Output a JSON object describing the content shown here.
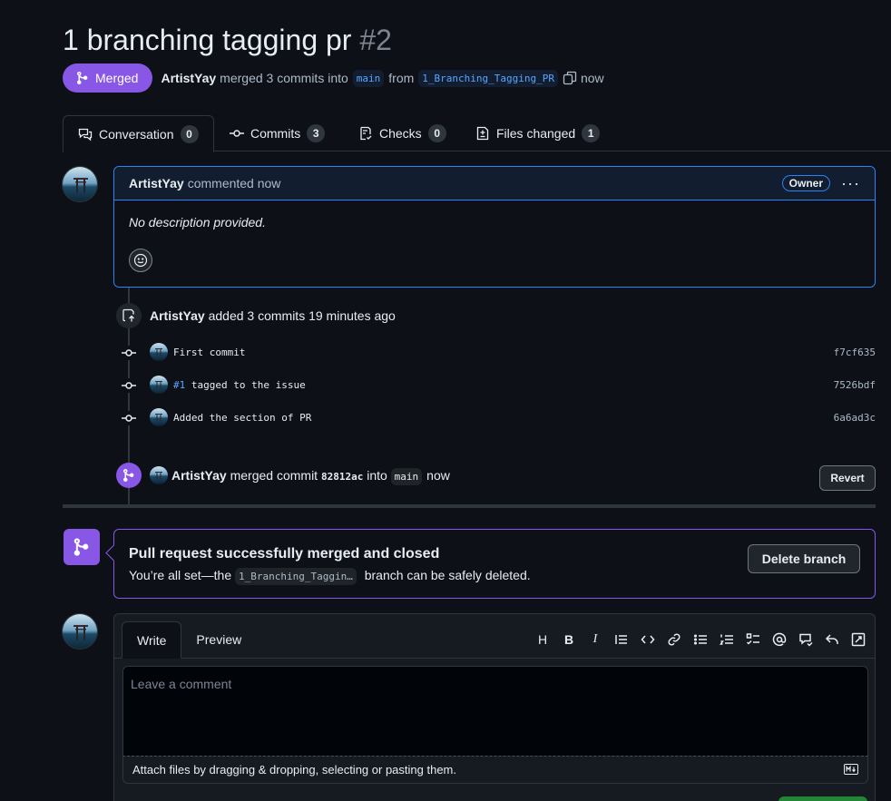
{
  "pr": {
    "title": "1 branching tagging pr",
    "number": "#2",
    "state_label": "Merged",
    "author": "ArtistYay",
    "merged_text": "merged 3 commits into",
    "base_branch": "main",
    "from_text": "from",
    "head_branch": "1_Branching_Tagging_PR",
    "time": "now"
  },
  "tabs": [
    {
      "label": "Conversation",
      "count": "0",
      "icon": "comment-discussion-icon"
    },
    {
      "label": "Commits",
      "count": "3",
      "icon": "git-commit-icon"
    },
    {
      "label": "Checks",
      "count": "0",
      "icon": "checklist-icon"
    },
    {
      "label": "Files changed",
      "count": "1",
      "icon": "file-diff-icon"
    }
  ],
  "comment": {
    "author": "ArtistYay",
    "action": "commented now",
    "badge": "Owner",
    "body": "No description provided."
  },
  "commits_event": {
    "author": "ArtistYay",
    "text": "added 3 commits 19 minutes ago"
  },
  "commits": [
    {
      "message": "First commit",
      "issue": "",
      "sha": "f7cf635"
    },
    {
      "message": "tagged to the issue",
      "issue": "#1",
      "sha": "7526bdf"
    },
    {
      "message": "Added the section of PR",
      "issue": "",
      "sha": "6a6ad3c"
    }
  ],
  "merge_event": {
    "author": "ArtistYay",
    "text1": "merged commit",
    "sha": "82812ac",
    "text2": "into",
    "branch": "main",
    "time": "now",
    "revert_label": "Revert"
  },
  "merge_box": {
    "title": "Pull request successfully merged and closed",
    "sub_prefix": "You’re all set—the",
    "branch": "1_Branching_Taggin…",
    "sub_suffix": "branch can be safely deleted.",
    "delete_label": "Delete branch"
  },
  "editor": {
    "tab_write": "Write",
    "tab_preview": "Preview",
    "placeholder": "Leave a comment",
    "attach_text": "Attach files by dragging & dropping, selecting or pasting them.",
    "toolbar": [
      "heading-icon",
      "bold-icon",
      "italic-icon",
      "quote-icon",
      "code-icon",
      "link-icon",
      "unordered-list-icon",
      "ordered-list-icon",
      "task-list-icon",
      "mention-icon",
      "cross-reference-icon",
      "reply-icon",
      "fullscreen-icon"
    ]
  },
  "colors": {
    "merged": "#8957e5",
    "accent": "#2f81f7",
    "background": "#0d1117"
  }
}
